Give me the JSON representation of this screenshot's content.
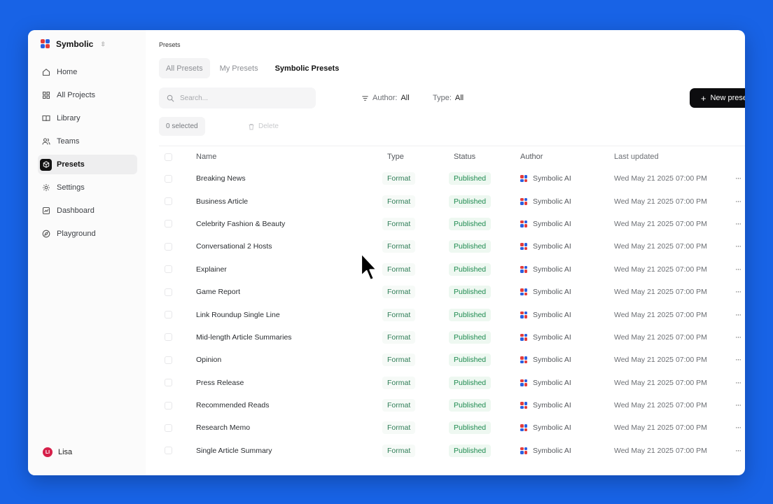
{
  "brand": {
    "name": "Symbolic"
  },
  "sidebar": {
    "items": [
      {
        "label": "Home",
        "icon": "home-icon"
      },
      {
        "label": "All Projects",
        "icon": "grid-icon"
      },
      {
        "label": "Library",
        "icon": "book-icon"
      },
      {
        "label": "Teams",
        "icon": "users-icon"
      },
      {
        "label": "Presets",
        "icon": "cube-icon",
        "active": true
      },
      {
        "label": "Settings",
        "icon": "gear-icon"
      },
      {
        "label": "Dashboard",
        "icon": "chart-icon"
      },
      {
        "label": "Playground",
        "icon": "compass-icon"
      }
    ],
    "user": {
      "initials": "LI",
      "name": "Lisa"
    }
  },
  "breadcrumb": "Presets",
  "tabs": [
    "All Presets",
    "My Presets",
    "Symbolic Presets"
  ],
  "search": {
    "placeholder": "Search..."
  },
  "filters": {
    "author_label": "Author:",
    "author_value": "All",
    "type_label": "Type:",
    "type_value": "All"
  },
  "new_button": "New preset",
  "selection": {
    "count_text": "0 selected",
    "delete_label": "Delete"
  },
  "table": {
    "headers": [
      "Name",
      "Type",
      "Status",
      "Author",
      "Last updated"
    ],
    "rows": [
      {
        "name": "Breaking News",
        "type": "Format",
        "status": "Published",
        "author": "Symbolic AI",
        "updated": "Wed May 21 2025 07:00 PM"
      },
      {
        "name": "Business Article",
        "type": "Format",
        "status": "Published",
        "author": "Symbolic AI",
        "updated": "Wed May 21 2025 07:00 PM"
      },
      {
        "name": "Celebrity Fashion & Beauty",
        "type": "Format",
        "status": "Published",
        "author": "Symbolic AI",
        "updated": "Wed May 21 2025 07:00 PM"
      },
      {
        "name": "Conversational 2 Hosts",
        "type": "Format",
        "status": "Published",
        "author": "Symbolic AI",
        "updated": "Wed May 21 2025 07:00 PM"
      },
      {
        "name": "Explainer",
        "type": "Format",
        "status": "Published",
        "author": "Symbolic AI",
        "updated": "Wed May 21 2025 07:00 PM"
      },
      {
        "name": "Game Report",
        "type": "Format",
        "status": "Published",
        "author": "Symbolic AI",
        "updated": "Wed May 21 2025 07:00 PM"
      },
      {
        "name": "Link Roundup Single Line",
        "type": "Format",
        "status": "Published",
        "author": "Symbolic AI",
        "updated": "Wed May 21 2025 07:00 PM"
      },
      {
        "name": "Mid-length Article Summaries",
        "type": "Format",
        "status": "Published",
        "author": "Symbolic AI",
        "updated": "Wed May 21 2025 07:00 PM"
      },
      {
        "name": "Opinion",
        "type": "Format",
        "status": "Published",
        "author": "Symbolic AI",
        "updated": "Wed May 21 2025 07:00 PM"
      },
      {
        "name": "Press Release",
        "type": "Format",
        "status": "Published",
        "author": "Symbolic AI",
        "updated": "Wed May 21 2025 07:00 PM"
      },
      {
        "name": "Recommended Reads",
        "type": "Format",
        "status": "Published",
        "author": "Symbolic AI",
        "updated": "Wed May 21 2025 07:00 PM"
      },
      {
        "name": "Research Memo",
        "type": "Format",
        "status": "Published",
        "author": "Symbolic AI",
        "updated": "Wed May 21 2025 07:00 PM"
      },
      {
        "name": "Single Article Summary",
        "type": "Format",
        "status": "Published",
        "author": "Symbolic AI",
        "updated": "Wed May 21 2025 07:00 PM"
      }
    ]
  },
  "colors": {
    "background": "#1863e6",
    "accent": "#0d0d0f",
    "published": "#1d8a4f",
    "format": "#2f7d57"
  }
}
